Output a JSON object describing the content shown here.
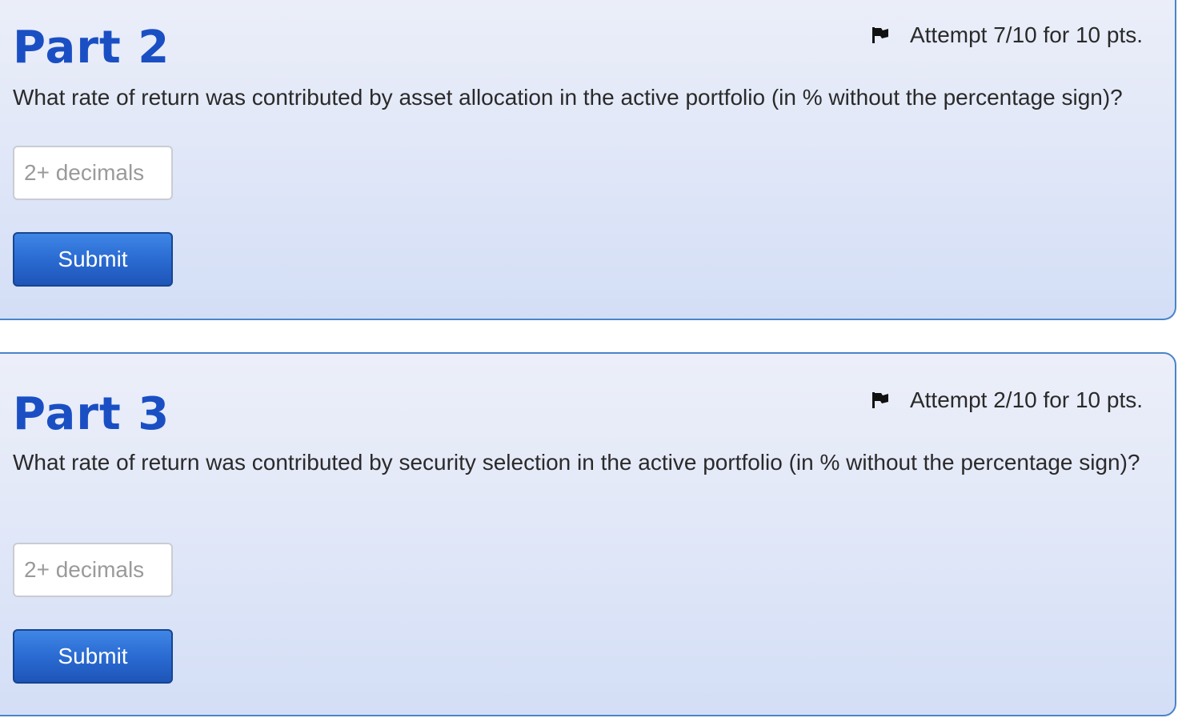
{
  "parts": [
    {
      "title": "Part 2",
      "attempt": "Attempt 7/10 for 10 pts.",
      "question": "What rate of return was contributed by asset allocation in the active portfolio (in % without the percentage sign)?",
      "input_placeholder": "2+ decimals",
      "input_value": "",
      "submit_label": "Submit"
    },
    {
      "title": "Part 3",
      "attempt": "Attempt 2/10 for 10 pts.",
      "question": "What rate of return was contributed by security selection in the active portfolio (in % without the percentage sign)?",
      "input_placeholder": "2+ decimals",
      "input_value": "",
      "submit_label": "Submit"
    }
  ],
  "icons": {
    "attempt_flag": "flag-icon"
  },
  "colors": {
    "title": "#1a4fc4",
    "card_border": "#4a84c9",
    "button": "#2a6bd2"
  }
}
